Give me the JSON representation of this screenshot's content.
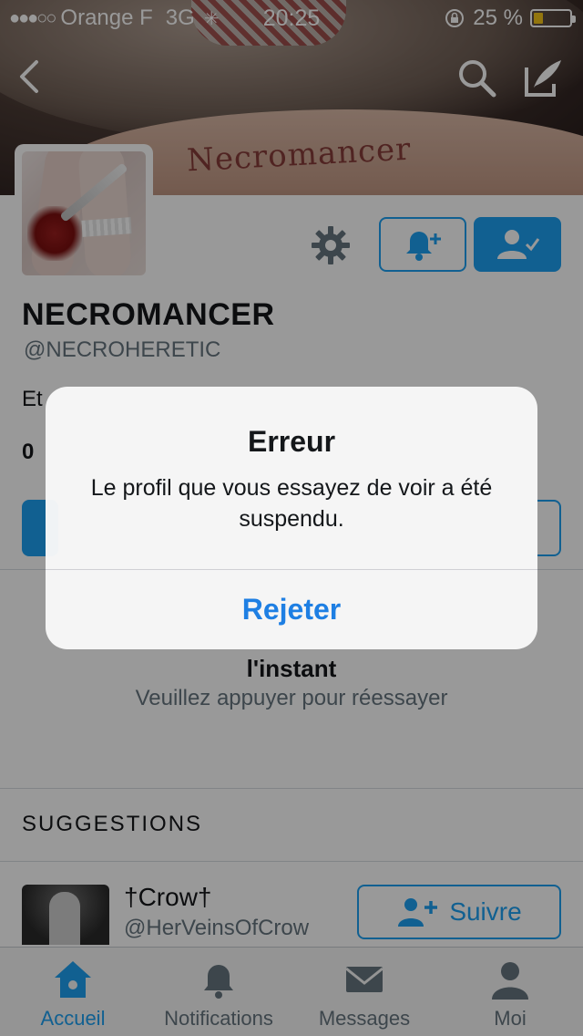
{
  "status_bar": {
    "signal_dots": "●●●○○",
    "carrier": "Orange F",
    "network": "3G",
    "time": "20:25",
    "battery_percent": "25 %",
    "battery_level": 0.25,
    "battery_color": "#f5c518"
  },
  "banner": {
    "tattoo_text": "Necromancer"
  },
  "profile": {
    "display_name": "NECROMANCER",
    "username": "@NECROHERETIC",
    "bio_partial": "Et",
    "counts_partial": "0"
  },
  "error_state": {
    "line_partial": "l'instant",
    "retry_text": "Veuillez appuyer pour réessayer"
  },
  "suggestions": {
    "title": "SUGGESTIONS",
    "items": [
      {
        "name": "†Crow†",
        "handle": "@HerVeinsOfCrow",
        "follow_label": "Suivre"
      }
    ]
  },
  "tabs": [
    {
      "label": "Accueil",
      "icon": "home-icon",
      "active": true
    },
    {
      "label": "Notifications",
      "icon": "bell-icon",
      "active": false
    },
    {
      "label": "Messages",
      "icon": "envelope-icon",
      "active": false
    },
    {
      "label": "Moi",
      "icon": "person-icon",
      "active": false
    }
  ],
  "alert": {
    "title": "Erreur",
    "message": "Le profil que vous essayez de voir a été suspendu.",
    "button_label": "Rejeter"
  },
  "colors": {
    "accent": "#1da1f2",
    "alert_button": "#1e7fe3",
    "secondary_text": "#66757f"
  }
}
